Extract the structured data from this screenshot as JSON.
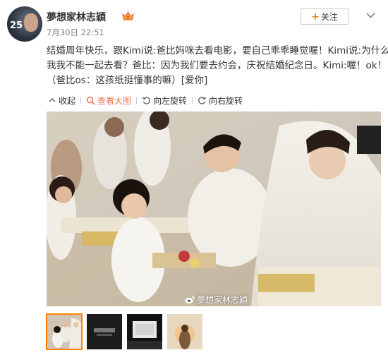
{
  "post": {
    "username": "夢想家林志穎",
    "timestamp": "7月30日 22:51",
    "text_lines": [
      "结婚周年快乐，跟Kimi说:爸比妈咪去看电影，要自己乖乖睡觉喔！Kimi说:为什么",
      "我我不能一起去看？爸比：因为我们要去约会，庆祝结婚纪念日。Kimi:喔！ok！",
      "（爸比os：这孩纸挺懂事的嘛）[爱你]"
    ],
    "avatar_badge": "25"
  },
  "header": {
    "follow_label": "关注",
    "follow_plus": "+"
  },
  "toolbar": {
    "collapse": "收起",
    "view_large": "查看大图",
    "rotate_left": "向左旋转",
    "rotate_right": "向右旋转"
  },
  "photo": {
    "watermark": "@夢想家林志穎",
    "watermark_handle": "夢想家林志穎"
  },
  "thumbnails": [
    {
      "id": "wedding-ceremony",
      "selected": true
    },
    {
      "id": "black-card"
    },
    {
      "id": "screen"
    },
    {
      "id": "sunset-figure"
    }
  ],
  "colors": {
    "accent_orange": "#ff8200",
    "active_toolbar": "#eb7350",
    "crown_gold": "#f5a623"
  },
  "icons": {
    "crown": "vip-crown-icon",
    "more": "chevron-down-icon",
    "collapse": "collapse-icon",
    "view_large": "magnify-icon",
    "rotate_left": "rotate-left-icon",
    "rotate_right": "rotate-right-icon",
    "weibo": "weibo-logo-icon"
  }
}
